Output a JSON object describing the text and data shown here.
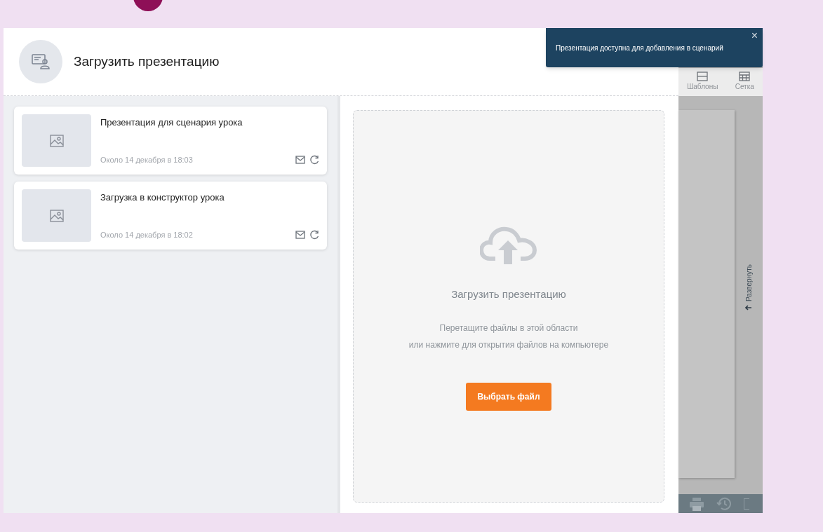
{
  "header": {
    "title": "Загрузить презентацию"
  },
  "presentations": [
    {
      "title": "Презентация для сценария урока",
      "date": "Около 14 декабря в 18:03"
    },
    {
      "title": "Загрузка в конструктор урока",
      "date": "Около 14 декабря в 18:02"
    }
  ],
  "upload": {
    "title": "Загрузить презентацию",
    "hint_lines": [
      "Перетащите файлы в этой области",
      "или нажмите для открытия файлов на компьютере"
    ],
    "button": "Выбрать файл"
  },
  "background_toolbar": [
    {
      "kind": "templates",
      "label": "Шаблоны"
    },
    {
      "kind": "grid",
      "label": "Сетка"
    }
  ],
  "side_tab": {
    "label": "Развернуть"
  },
  "toast": {
    "message": "Презентация доступна для добавления в сценарий",
    "close": "×"
  }
}
